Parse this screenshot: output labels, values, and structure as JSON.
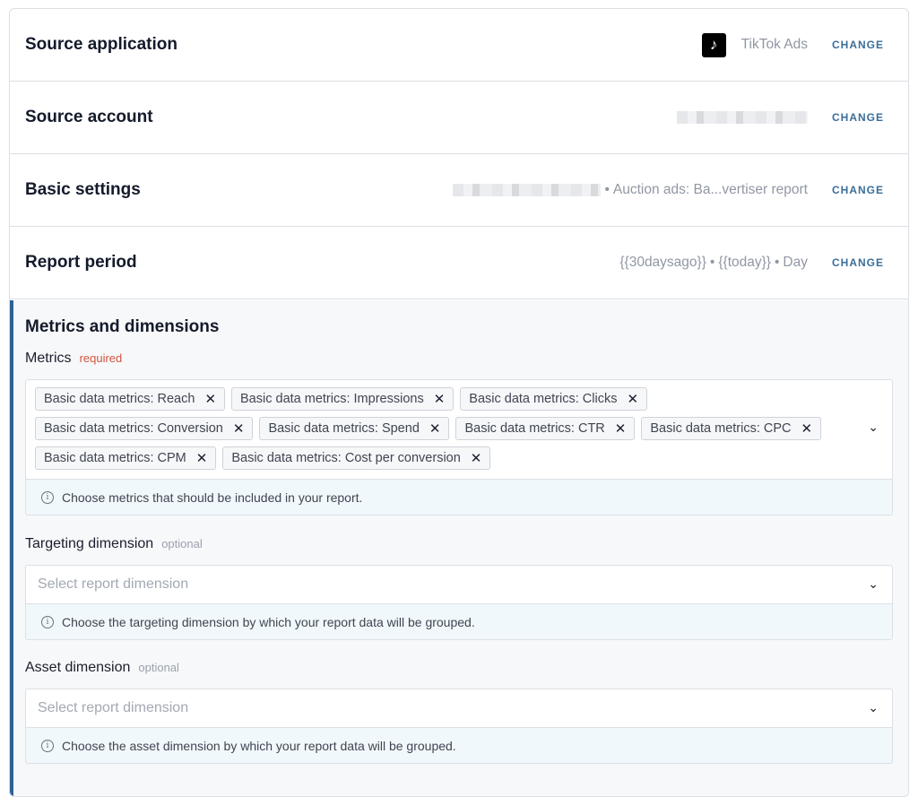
{
  "source_application": {
    "title": "Source application",
    "app_name": "TikTok Ads",
    "change": "CHANGE",
    "logo_glyph": "♪"
  },
  "source_account": {
    "title": "Source account",
    "change": "CHANGE"
  },
  "basic_settings": {
    "title": "Basic settings",
    "summary": "Auction ads: Ba...vertiser report",
    "change": "CHANGE"
  },
  "report_period": {
    "title": "Report period",
    "start": "{{30daysago}}",
    "end": "{{today}}",
    "granularity": "Day",
    "change": "CHANGE"
  },
  "metrics_section": {
    "title": "Metrics and dimensions",
    "metrics": {
      "label": "Metrics",
      "badge": "required",
      "chips": [
        "Basic data metrics: Reach",
        "Basic data metrics: Impressions",
        "Basic data metrics: Clicks",
        "Basic data metrics: Conversion",
        "Basic data metrics: Spend",
        "Basic data metrics: CTR",
        "Basic data metrics: CPC",
        "Basic data metrics: CPM",
        "Basic data metrics: Cost per conversion"
      ],
      "hint": "Choose metrics that should be included in your report."
    },
    "targeting": {
      "label": "Targeting dimension",
      "badge": "optional",
      "placeholder": "Select report dimension",
      "hint": "Choose the targeting dimension by which your report data will be grouped."
    },
    "asset": {
      "label": "Asset dimension",
      "badge": "optional",
      "placeholder": "Select report dimension",
      "hint": "Choose the asset dimension by which your report data will be grouped."
    }
  },
  "icons": {
    "remove": "✕",
    "chevron": "⌄",
    "info": "i"
  },
  "colors": {
    "accent": "#2e6395",
    "change_link": "#3a6e9a",
    "required": "#d0553f",
    "hint_bg": "#f1f8fb"
  }
}
